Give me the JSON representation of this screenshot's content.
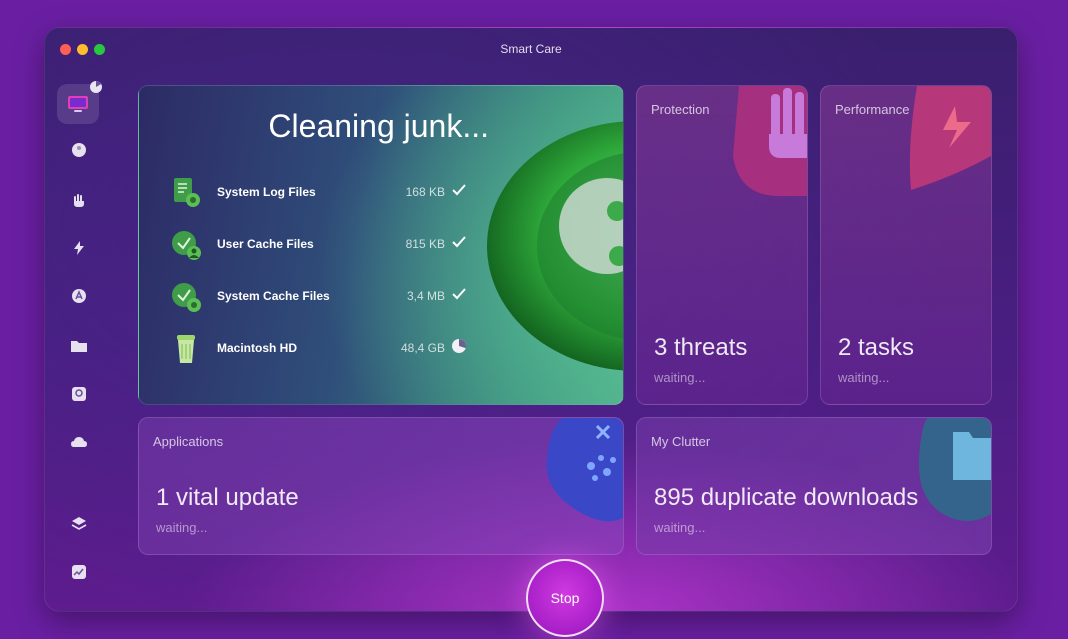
{
  "window": {
    "title": "Smart Care"
  },
  "sidebar": {
    "items": [
      {
        "icon": "smart-care-icon",
        "active": true
      },
      {
        "icon": "cleanup-icon"
      },
      {
        "icon": "protection-hand-icon"
      },
      {
        "icon": "performance-bolt-icon"
      },
      {
        "icon": "applications-icon"
      },
      {
        "icon": "my-clutter-folder-icon"
      },
      {
        "icon": "space-lens-icon"
      },
      {
        "icon": "cloud-cleanup-icon"
      },
      {
        "icon": "shredder-layers-icon"
      },
      {
        "icon": "activity-monitor-icon"
      }
    ]
  },
  "main": {
    "title": "Cleaning junk...",
    "items": [
      {
        "name": "System Log Files",
        "size": "168 KB",
        "status": "done"
      },
      {
        "name": "User Cache Files",
        "size": "815 KB",
        "status": "done"
      },
      {
        "name": "System Cache Files",
        "size": "3,4 MB",
        "status": "done"
      },
      {
        "name": "Macintosh HD",
        "size": "48,4 GB",
        "status": "in-progress",
        "progress": 0.3
      }
    ]
  },
  "protection": {
    "label": "Protection",
    "value": "3 threats",
    "status": "waiting..."
  },
  "performance": {
    "label": "Performance",
    "value": "2 tasks",
    "status": "waiting..."
  },
  "applications": {
    "label": "Applications",
    "value": "1 vital update",
    "status": "waiting..."
  },
  "clutter": {
    "label": "My Clutter",
    "value": "895 duplicate downloads",
    "status": "waiting..."
  },
  "stop_button": {
    "label": "Stop"
  },
  "colors": {
    "background": "#6a1fa3",
    "accent_green": "#4fc16a",
    "stop_button": "#c12ed8"
  }
}
